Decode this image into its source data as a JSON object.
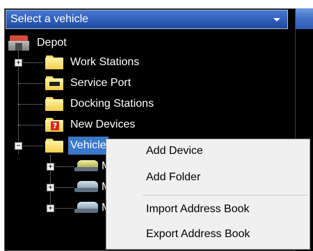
{
  "selector": {
    "placeholder": "Select a vehicle",
    "icon": "chevron-down-icon"
  },
  "tree": {
    "root": {
      "label": "Depot",
      "icon": "depot-icon"
    },
    "children": [
      {
        "label": "Work Stations",
        "icon": "folder-icon",
        "expandable": true
      },
      {
        "label": "Service Port",
        "icon": "service-port-icon",
        "expandable": false
      },
      {
        "label": "Docking Stations",
        "icon": "folder-icon",
        "expandable": false
      },
      {
        "label": "New Devices",
        "icon": "question-folder-icon",
        "expandable": false
      },
      {
        "label": "Vehicle",
        "icon": "folder-icon",
        "expandable": true,
        "expanded": true,
        "selected": true
      }
    ],
    "vehicle_children": [
      {
        "label": "M",
        "icon": "vehicle-icon"
      },
      {
        "label": "M",
        "icon": "vehicle-icon"
      },
      {
        "label": "M",
        "icon": "vehicle-icon"
      }
    ]
  },
  "context_menu": {
    "items": [
      {
        "label": "Add Device"
      },
      {
        "label": "Add Folder"
      },
      {
        "label": "Import Address Book"
      },
      {
        "label": "Export Address Book"
      }
    ]
  },
  "colors": {
    "panel_bg": "#000000",
    "selector_blue": "#2d5db8",
    "selection": "#3a78c8",
    "menu_bg": "#f0f0f0"
  }
}
